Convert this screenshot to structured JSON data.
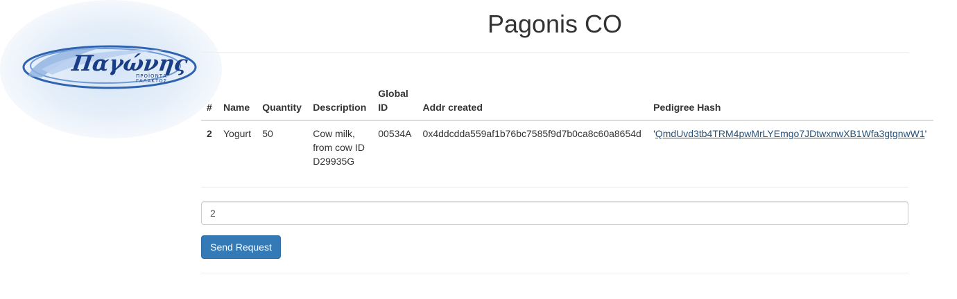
{
  "logo": {
    "brand_text": "Παγώνης",
    "sub_line1": "ΠΡΟΪΟΝΤΑ",
    "sub_line2": "ΓΑΛΑΚΤΟΣ",
    "brand_color": "#1a3e86"
  },
  "header": {
    "title": "Pagonis CO"
  },
  "table": {
    "columns": [
      "#",
      "Name",
      "Quantity",
      "Description",
      "Global ID",
      "Addr created",
      "Pedigree Hash"
    ],
    "rows": [
      {
        "num": "2",
        "name": "Yogurt",
        "quantity": "50",
        "description": "Cow milk, from cow ID D29935G",
        "global_id": "00534A",
        "addr_created": "0x4ddcdda559af1b76bc7585f9d7b0ca8c60a8654d",
        "pedigree_hash": "QmdUvd3tb4TRM4pwMrLYEmgo7JDtwxnwXB1Wfa3gtgnwW1",
        "hash_prefix": "'",
        "hash_suffix": "'"
      }
    ]
  },
  "request": {
    "input_value": "2",
    "send_label": "Send Request"
  },
  "colors": {
    "primary": "#337ab7",
    "link": "#23527c",
    "text": "#333333"
  }
}
